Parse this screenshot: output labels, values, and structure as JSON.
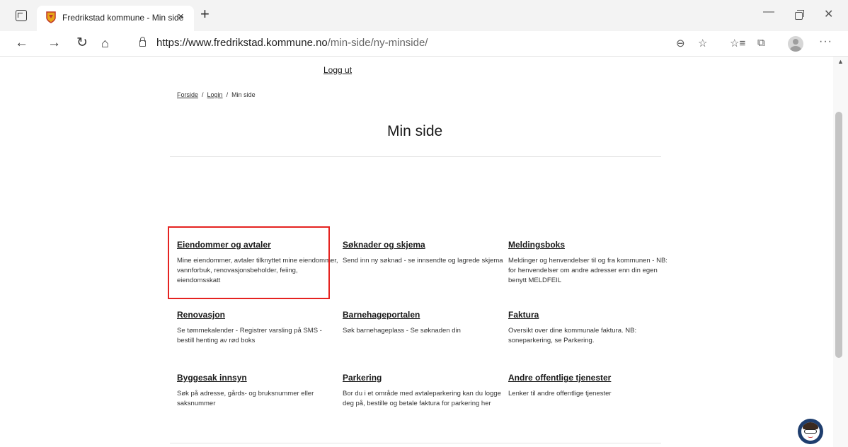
{
  "browser": {
    "tab_title": "Fredrikstad kommune - Min side",
    "tab_close": "×",
    "new_tab": "+",
    "url_host": "https://www.fredrikstad.kommune.no",
    "url_path": "/min-side/ny-minside/",
    "icons": {
      "back": "←",
      "forward": "→",
      "reload": "↻",
      "home": "⌂",
      "zoom": "⊖",
      "add_favorite": "☆",
      "favorites": "☆≡",
      "collections": "⧉",
      "more": "···",
      "minimize": "—",
      "close": "✕"
    }
  },
  "page": {
    "logout_label": "Logg ut",
    "breadcrumb": {
      "home": "Forside",
      "login": "Login",
      "current": "Min side",
      "separator": "/"
    },
    "title": "Min side",
    "cards": [
      {
        "title": "Eiendommer og avtaler",
        "desc": "Mine eiendommer, avtaler tilknyttet mine eiendommer, vannforbuk, renovasjonsbeholder, feiing, eiendomsskatt",
        "highlighted": true
      },
      {
        "title": "Søknader og skjema",
        "desc": "Send inn ny søknad -  se innsendte og lagrede skjema"
      },
      {
        "title": "Meldingsboks",
        "desc": "Meldinger og henvendelser til og fra kommunen - NB: for henvendelser om andre adresser enn din egen benytt MELDFEIL"
      },
      {
        "title": "Renovasjon",
        "desc": "Se tømmekalender - Registrer varsling på SMS - bestill henting av rød boks"
      },
      {
        "title": "Barnehageportalen",
        "desc": "Søk barnehageplass - Se søknaden din"
      },
      {
        "title": "Faktura",
        "desc": "Oversikt over dine kommunale faktura. NB: soneparkering, se Parkering."
      },
      {
        "title": "Byggesak innsyn",
        "desc": "Søk på adresse, gårds- og bruksnummer eller saksnummer"
      },
      {
        "title": "Parkering",
        "desc": "Bor du i et område med avtaleparkering kan du logge deg på, bestille og betale faktura for parkering her"
      },
      {
        "title": "Andre offentlige tjenester",
        "desc": "Lenker til andre offentlige tjenester"
      }
    ],
    "highlight_color": "#e52320"
  }
}
